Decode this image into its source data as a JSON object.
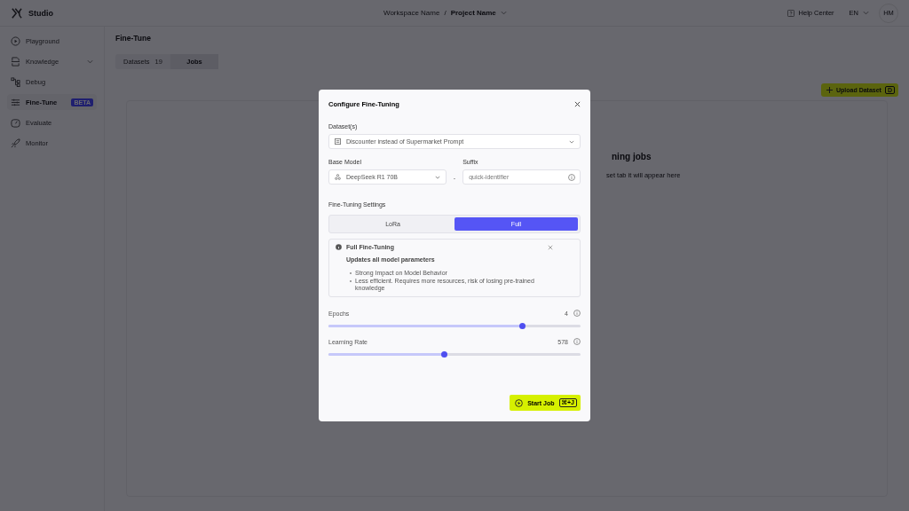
{
  "header": {
    "brand": "Studio",
    "workspace": "Workspace Name",
    "separator": "/",
    "project": "Project Name",
    "help": "Help Center",
    "language": "EN",
    "avatar": "HM"
  },
  "sidebar": {
    "items": [
      {
        "label": "Playground",
        "kind": "play",
        "selected": false,
        "expandable": false
      },
      {
        "label": "Knowledge",
        "kind": "file",
        "selected": false,
        "expandable": true
      },
      {
        "label": "Debug",
        "kind": "flow",
        "selected": false,
        "expandable": false
      },
      {
        "label": "Fine-Tune",
        "kind": "sliders",
        "selected": true,
        "expandable": false,
        "badge": "BETA"
      },
      {
        "label": "Evaluate",
        "kind": "gauge",
        "selected": false,
        "expandable": false
      },
      {
        "label": "Monitor",
        "kind": "rocket",
        "selected": false,
        "expandable": false
      }
    ]
  },
  "page": {
    "title": "Fine-Tune",
    "tabs": [
      {
        "label": "Datasets",
        "count": "19",
        "selected": false
      },
      {
        "label": "Jobs",
        "selected": true
      }
    ],
    "upload_button": {
      "label": "Upload Dataset",
      "shortcut": "D"
    },
    "empty_state": {
      "title": "ning jobs",
      "text": "set tab it will appear here"
    }
  },
  "dialog": {
    "title": "Configure Fine-Tuning",
    "dataset": {
      "label": "Dataset(s)",
      "value": "Discounter instead of Supermarket Prompt"
    },
    "base_model": {
      "label": "Base Model",
      "value": "DeepSeek R1 70B"
    },
    "separator": "-",
    "suffix": {
      "label": "Suffix",
      "placeholder": "quick-identifier"
    },
    "settings_label": "Fine-Tuning Settings",
    "modes": [
      {
        "label": "LoRa",
        "selected": false
      },
      {
        "label": "Full",
        "selected": true
      }
    ],
    "info": {
      "title": "Full Fine-Tuning",
      "subtitle": "Updates all model parameters",
      "bullets": [
        "Strong Impact on Model Behavior",
        "Less efficient. Requires more resources, risk of losing pre-trained knowledge"
      ]
    },
    "sliders": [
      {
        "label": "Epochs",
        "reading": "4",
        "level": 0.77
      },
      {
        "label": "Learning Rate",
        "reading": "578",
        "level": 0.46
      }
    ],
    "start_button": {
      "label": "Start Job",
      "shortcut": "⌘+J"
    }
  }
}
